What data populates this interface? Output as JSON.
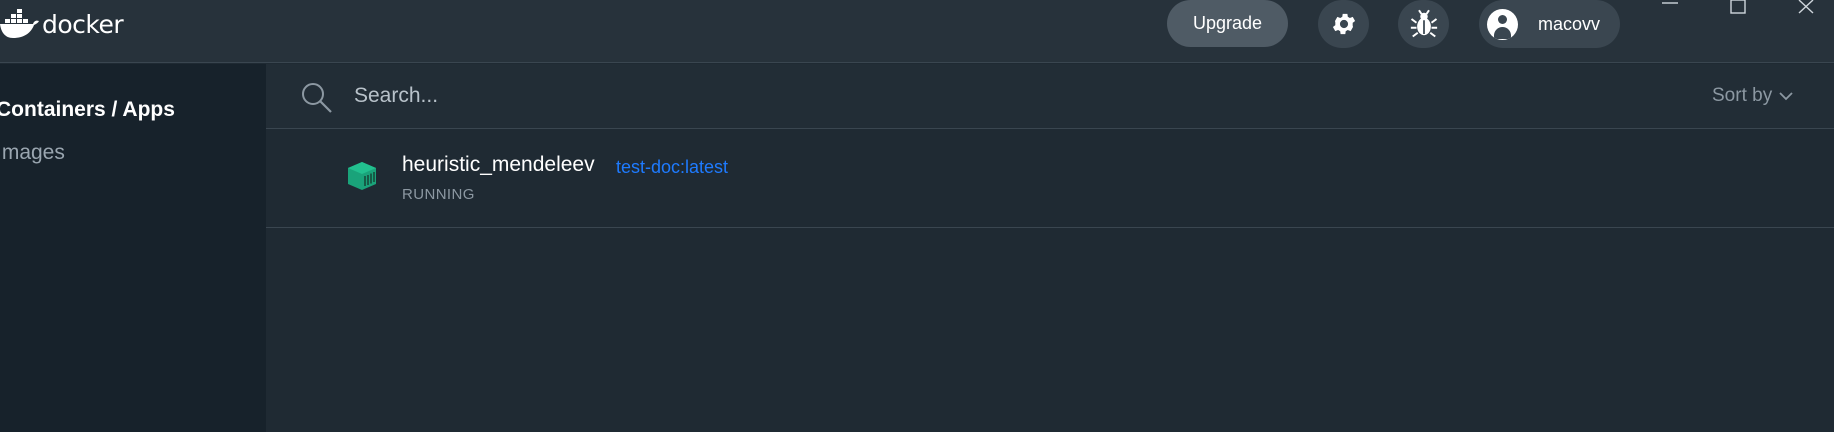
{
  "header": {
    "logo_text": "docker",
    "upgrade_label": "Upgrade",
    "settings_icon": "gear-icon",
    "troubleshoot_icon": "bug-icon",
    "user": {
      "name": "macovv",
      "icon": "user-icon"
    },
    "window_controls": [
      "minimize-icon",
      "maximize-icon",
      "close-icon"
    ]
  },
  "sidebar": {
    "items": [
      {
        "label": "Containers / Apps",
        "active": true
      },
      {
        "label": "Images",
        "active": false
      }
    ]
  },
  "search": {
    "placeholder": "Search...",
    "value": ""
  },
  "sort": {
    "label": "Sort by"
  },
  "containers": [
    {
      "name": "heuristic_mendeleev",
      "image": "test-doc:latest",
      "status": "RUNNING",
      "status_color": "#1aa37a"
    }
  ],
  "colors": {
    "accent": "#1e7bff",
    "running": "#1aa37a",
    "background": "#1f2a33",
    "sidebar": "#17222b"
  }
}
